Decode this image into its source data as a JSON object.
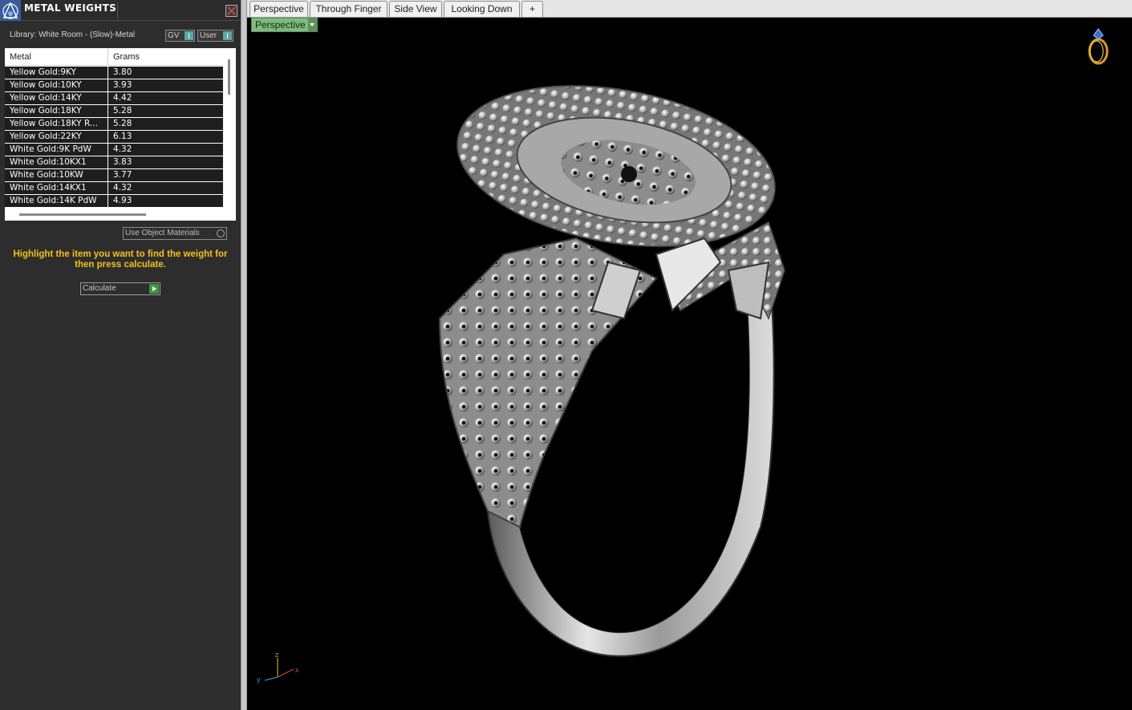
{
  "panel": {
    "title": "METAL WEIGHTS",
    "library_label": "Library: White Room - (Slow)-Metal",
    "gv_label": "GV",
    "user_label": "User",
    "table": {
      "headers": [
        "Metal",
        "Grams"
      ],
      "rows": [
        {
          "metal": "Yellow Gold:9KY",
          "grams": "3.80"
        },
        {
          "metal": "Yellow Gold:10KY",
          "grams": "3.93"
        },
        {
          "metal": "Yellow Gold:14KY",
          "grams": "4.42"
        },
        {
          "metal": "Yellow Gold:18KY",
          "grams": "5.28"
        },
        {
          "metal": "Yellow Gold:18KY R...",
          "grams": "5.28"
        },
        {
          "metal": "Yellow Gold:22KY",
          "grams": "6.13"
        },
        {
          "metal": "White Gold:9K PdW",
          "grams": "4.32"
        },
        {
          "metal": "White Gold:10KX1",
          "grams": "3.83"
        },
        {
          "metal": "White Gold:10KW",
          "grams": "3.77"
        },
        {
          "metal": "White Gold:14KX1",
          "grams": "4.32"
        },
        {
          "metal": "White Gold:14K PdW",
          "grams": "4.93"
        }
      ]
    },
    "use_materials_label": "Use Object Materials",
    "hint": "Highlight the item you want to find the weight for then press calculate.",
    "calculate_label": "Calculate",
    "hint_color": "#f2c21a"
  },
  "viewport": {
    "tabs": [
      "Perspective",
      "Through Finger",
      "Side View",
      "Looking Down"
    ],
    "active_tab": "Perspective",
    "view_mode": "Perspective",
    "add_tab_symbol": "+",
    "accent_color": "#7fba7f",
    "axis_labels": {
      "x": "x",
      "y": "y",
      "z": "z"
    }
  }
}
